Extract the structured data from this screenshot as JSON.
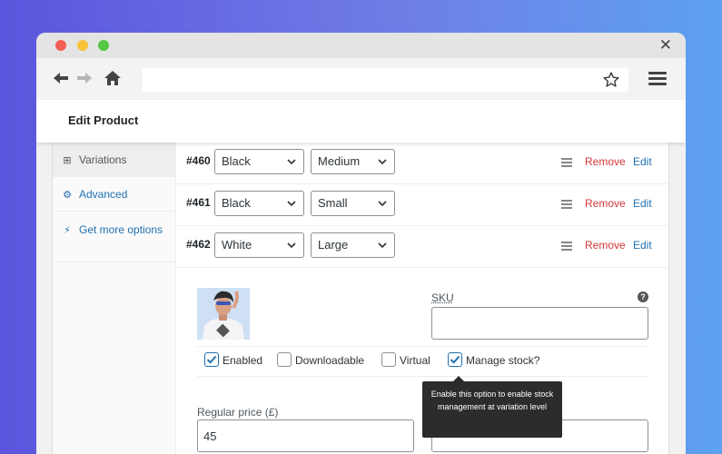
{
  "page": {
    "title": "Edit Product"
  },
  "browser": {
    "url": ""
  },
  "sidebar": {
    "items": [
      {
        "label": "Variations",
        "icon": "grid-icon",
        "active": true
      },
      {
        "label": "Advanced",
        "icon": "gear-icon"
      },
      {
        "label": "Get more options",
        "icon": "plug-icon"
      }
    ]
  },
  "variations": [
    {
      "id": "#460",
      "color": "Black",
      "size": "Medium",
      "remove": "Remove",
      "edit": "Edit"
    },
    {
      "id": "#461",
      "color": "Black",
      "size": "Small",
      "remove": "Remove",
      "edit": "Edit"
    },
    {
      "id": "#462",
      "color": "White",
      "size": "Large",
      "remove": "Remove",
      "edit": "Edit"
    }
  ],
  "detail": {
    "sku_label": "SKU",
    "sku_value": "",
    "options": [
      {
        "label": "Enabled",
        "checked": true
      },
      {
        "label": "Downloadable",
        "checked": false
      },
      {
        "label": "Virtual",
        "checked": false
      },
      {
        "label": "Manage stock?",
        "checked": true
      }
    ],
    "regular_price_label": "Regular price (£)",
    "regular_price_value": "45",
    "tooltip": "Enable this option to enable stock management at variation level"
  },
  "colors": {
    "link": "#2271b1",
    "remove": "#d63638",
    "accent": "#2271b1"
  }
}
